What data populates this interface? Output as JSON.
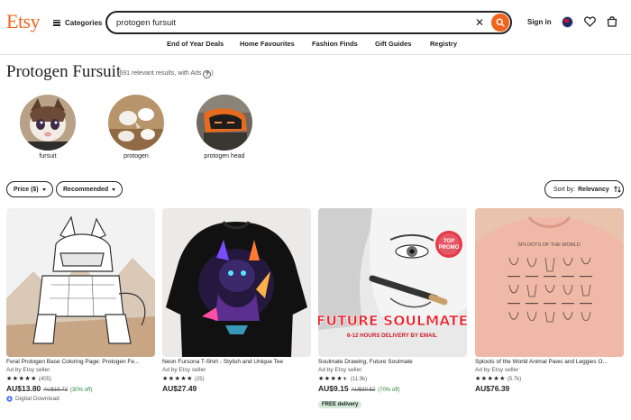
{
  "header": {
    "logo": "Etsy",
    "categories_label": "Categories",
    "search_value": "protogen fursuit",
    "sign_in": "Sign in"
  },
  "nav": [
    {
      "label": "End of Year Deals"
    },
    {
      "label": "Home Favourites"
    },
    {
      "label": "Fashion Finds"
    },
    {
      "label": "Gift Guides"
    },
    {
      "label": "Registry"
    }
  ],
  "page": {
    "title": "Protogen Fursuit",
    "results": "(691 relevant results, with Ads"
  },
  "related": [
    {
      "label": "fursuit"
    },
    {
      "label": "protogen"
    },
    {
      "label": "protogen head"
    }
  ],
  "filters": {
    "price": "Price ($)",
    "recommended": "Recommended",
    "sort_prefix": "Sort by:",
    "sort_value": "Relevancy"
  },
  "listings": [
    {
      "title": "Feral Protogen Base Coloring Page: Protogen Fe...",
      "ad": "Ad by Etsy seller",
      "stars": 5,
      "reviews": "(405)",
      "price": "AU$13.80",
      "original_price": "AU$19.72",
      "discount": "(30% off)",
      "extra": "Digital Download"
    },
    {
      "title": "Neon Fursona T-Shirt - Stylish and Unique Tee",
      "ad": "Ad by Etsy seller",
      "stars": 5,
      "reviews": "(25)",
      "price": "AU$27.49"
    },
    {
      "title": "Soulmate Drawing, Future Soulmate",
      "ad": "Ad by Etsy seller",
      "stars": 4.5,
      "reviews": "(11.9k)",
      "price": "AU$9.15",
      "original_price": "AU$30.52",
      "discount": "(70% off)",
      "badge": "FREE delivery",
      "image_text": {
        "headline": "FUTURE SOULMATE",
        "sub": "6-12 HOURS DELIVERY BY EMAIL",
        "promo_top": "TOP",
        "promo_bottom": "PROMO"
      }
    },
    {
      "title": "Sploots of the World Animal Paws and Leggies O...",
      "ad": "Ad by Etsy seller",
      "stars": 5,
      "reviews": "(5.7k)",
      "price": "AU$76.39",
      "image_text": {
        "shirt_heading": "SPLOOTS OF THE WORLD"
      }
    }
  ],
  "colors": {
    "brand": "#F1641E",
    "discount": "#258635",
    "badge_bg": "#d4e9d7"
  }
}
